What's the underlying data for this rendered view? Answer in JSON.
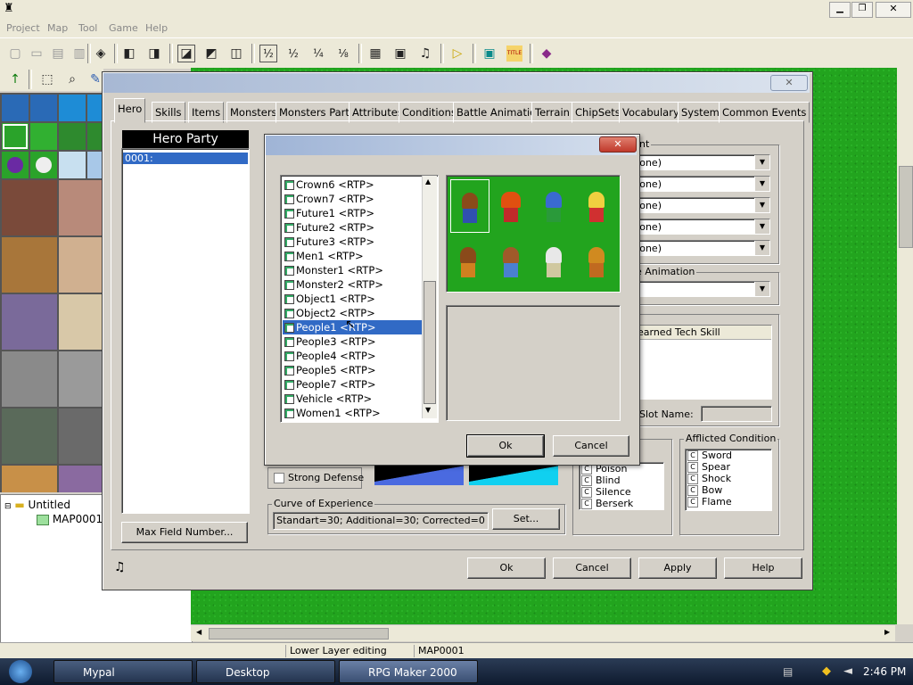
{
  "menubar": {
    "items": [
      "Project",
      "Map",
      "Tool",
      "Game",
      "Help"
    ]
  },
  "window_controls": [
    "minimize",
    "restore",
    "close"
  ],
  "tree": {
    "root": "Untitled",
    "child": "MAP0001"
  },
  "map_button_label": "Max Field Number...",
  "statusbar": {
    "mode": "Lower Layer editing mode",
    "map": "MAP0001"
  },
  "taskbar": {
    "items": [
      "Mypal",
      "Desktop",
      "RPG Maker 2000"
    ],
    "time": "2:46 PM"
  },
  "database": {
    "tabs": [
      "Hero",
      "Skills",
      "Items",
      "Monsters",
      "Monsters Party",
      "Attributes",
      "Conditions",
      "Battle Animation",
      "Terrain",
      "ChipSets",
      "Vocabulary",
      "System",
      "Common Events"
    ],
    "selected_tab": "Hero",
    "hero_list_title": "Hero Party",
    "hero_list": [
      "0001:"
    ],
    "equipment_label": "nt",
    "equipment_values": [
      "None)",
      "None)",
      "None)",
      "None)",
      "None)"
    ],
    "animation_label": "e Animation",
    "tech_skill_header": "earned Tech Skill",
    "slot_name_label": "Slot Name:",
    "attribute_group_label": "ct",
    "attribute_list": [
      "Poison",
      "Blind",
      "Silence",
      "Berserk"
    ],
    "condition_group_label": "Afflicted Condition",
    "condition_list": [
      "Sword",
      "Spear",
      "Shock",
      "Bow",
      "Flame"
    ],
    "strong_defense_label": "Strong Defense",
    "curve_group_label": "Curve of Experience",
    "curve_value": "Standart=30; Additional=30; Corrected=0",
    "set_button": "Set...",
    "ok_button": "Ok",
    "cancel_button": "Cancel",
    "apply_button": "Apply",
    "help_button": "Help"
  },
  "charset_dialog": {
    "items": [
      "Crown6 <RTP>",
      "Crown7 <RTP>",
      "Future1 <RTP>",
      "Future2 <RTP>",
      "Future3 <RTP>",
      "Men1 <RTP>",
      "Monster1 <RTP>",
      "Monster2 <RTP>",
      "Object1 <RTP>",
      "Object2 <RTP>",
      "People1 <RTP>",
      "People3 <RTP>",
      "People4 <RTP>",
      "People5 <RTP>",
      "People7 <RTP>",
      "Vehicle <RTP>",
      "Women1 <RTP>"
    ],
    "selected": "People1 <RTP>",
    "ok_button": "Ok",
    "cancel_button": "Cancel",
    "preview_background": "#22a41e"
  }
}
